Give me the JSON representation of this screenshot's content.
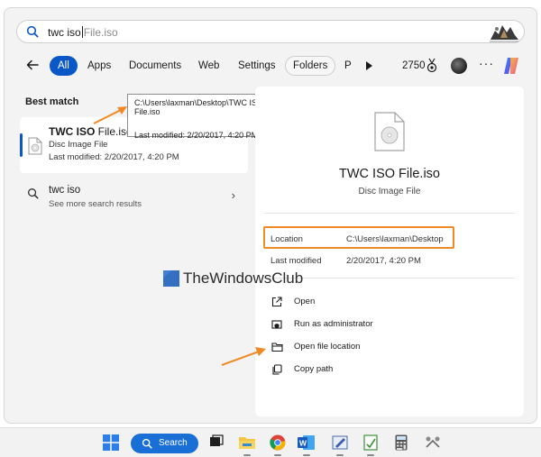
{
  "search": {
    "typed": "twc iso",
    "suggestion": "File.iso"
  },
  "filters": {
    "items": [
      "All",
      "Apps",
      "Documents",
      "Web",
      "Settings",
      "Folders",
      "P"
    ],
    "active": "All",
    "points": "2750"
  },
  "results": {
    "section_label": "Best match",
    "best": {
      "title_bold": "TWC ISO",
      "title_rest": " File.iso",
      "type": "Disc Image File",
      "modified": "Last modified: 2/20/2017, 4:20 PM"
    },
    "web": {
      "title": "twc iso",
      "subtitle": "See more search results"
    }
  },
  "tooltip": {
    "path": "C:\\Users\\laxman\\Desktop\\TWC ISO File.iso",
    "modified": "Last modified: 2/20/2017, 4:20 PM"
  },
  "preview": {
    "title": "TWC ISO File.iso",
    "type": "Disc Image File",
    "location_label": "Location",
    "location_value": "C:\\Users\\laxman\\Desktop",
    "modified_label": "Last modified",
    "modified_value": "2/20/2017, 4:20 PM",
    "actions": [
      "Open",
      "Run as administrator",
      "Open file location",
      "Copy path"
    ]
  },
  "watermark": "TheWindowsClub",
  "taskbar": {
    "search_label": "Search"
  },
  "colors": {
    "accent": "#0a58c8",
    "highlight": "#f08a24"
  }
}
